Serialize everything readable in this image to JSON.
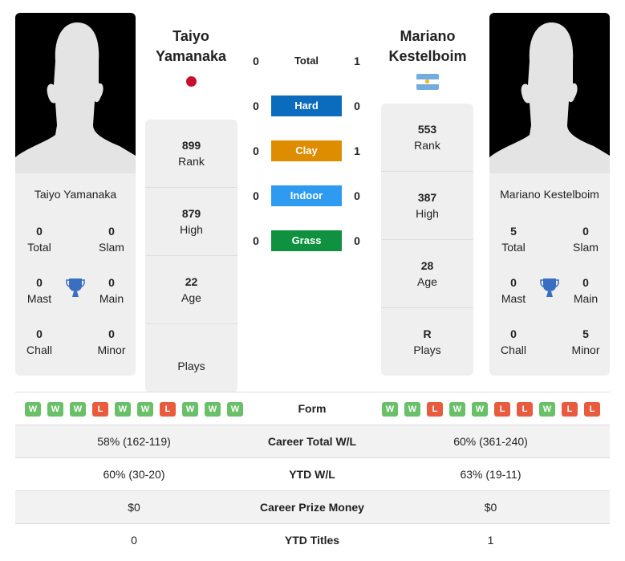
{
  "player1": {
    "name": "Taiyo Yamanaka",
    "name_line1": "Taiyo",
    "name_line2": "Yamanaka",
    "country": "Japan",
    "titles": {
      "total": "0",
      "slam": "0",
      "mast": "0",
      "main": "0",
      "chall": "0",
      "minor": "0"
    },
    "stats": {
      "rank": "899",
      "high": "879",
      "age": "22",
      "plays": ""
    }
  },
  "player2": {
    "name": "Mariano Kestelboim",
    "name_line1": "Mariano",
    "name_line2": "Kestelboim",
    "country": "Argentina",
    "titles": {
      "total": "5",
      "slam": "0",
      "mast": "0",
      "main": "0",
      "chall": "0",
      "minor": "5"
    },
    "stats": {
      "rank": "553",
      "high": "387",
      "age": "28",
      "plays": "R"
    }
  },
  "labels": {
    "total": "Total",
    "slam": "Slam",
    "mast": "Mast",
    "main": "Main",
    "chall": "Chall",
    "minor": "Minor",
    "rank": "Rank",
    "high": "High",
    "age": "Age",
    "plays": "Plays"
  },
  "h2h": {
    "total": {
      "label": "Total",
      "p1": "0",
      "p2": "1"
    },
    "surfaces": [
      {
        "label": "Hard",
        "p1": "0",
        "p2": "0",
        "color": "#0b6bbd"
      },
      {
        "label": "Clay",
        "p1": "0",
        "p2": "1",
        "color": "#de8c00"
      },
      {
        "label": "Indoor",
        "p1": "0",
        "p2": "0",
        "color": "#2e9bf0"
      },
      {
        "label": "Grass",
        "p1": "0",
        "p2": "0",
        "color": "#0f9140"
      }
    ]
  },
  "comparison": {
    "form_label": "Form",
    "p1_form": [
      "W",
      "W",
      "W",
      "L",
      "W",
      "W",
      "L",
      "W",
      "W",
      "W"
    ],
    "p2_form": [
      "W",
      "W",
      "L",
      "W",
      "W",
      "L",
      "L",
      "W",
      "L",
      "L"
    ],
    "rows": [
      {
        "label": "Career Total W/L",
        "p1": "58% (162-119)",
        "p2": "60% (361-240)"
      },
      {
        "label": "YTD W/L",
        "p1": "60% (30-20)",
        "p2": "63% (19-11)"
      },
      {
        "label": "Career Prize Money",
        "p1": "$0",
        "p2": "$0"
      },
      {
        "label": "YTD Titles",
        "p1": "0",
        "p2": "1"
      }
    ]
  },
  "colors": {
    "win": "#6abf69",
    "loss": "#e95b3e",
    "trophy": "#3a6fc0"
  }
}
